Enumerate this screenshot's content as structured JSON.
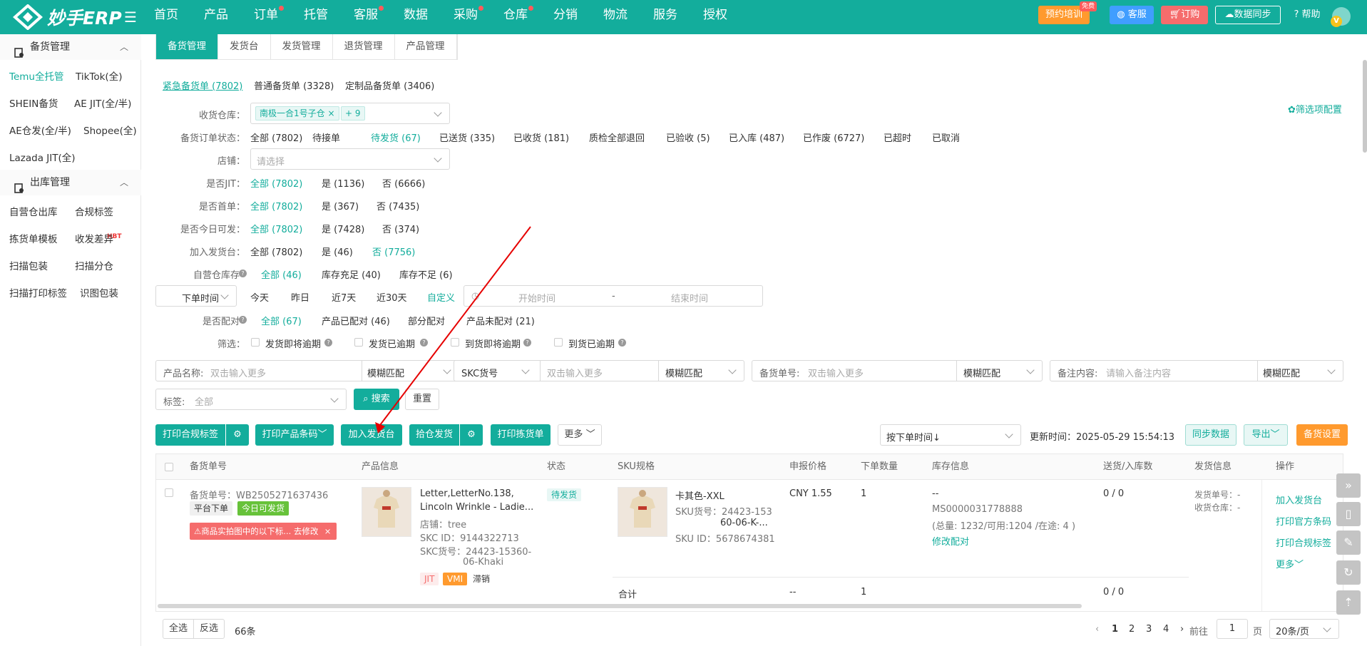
{
  "app": {
    "name": "妙手ERP"
  },
  "nav": [
    {
      "label": "首页",
      "dot": false
    },
    {
      "label": "产品",
      "dot": false
    },
    {
      "label": "订单",
      "dot": true
    },
    {
      "label": "托管",
      "dot": false
    },
    {
      "label": "客服",
      "dot": true
    },
    {
      "label": "数据",
      "dot": false
    },
    {
      "label": "采购",
      "dot": true
    },
    {
      "label": "仓库",
      "dot": true
    },
    {
      "label": "分销",
      "dot": false
    },
    {
      "label": "物流",
      "dot": false
    },
    {
      "label": "服务",
      "dot": false
    },
    {
      "label": "授权",
      "dot": false
    }
  ],
  "topright": {
    "training": "预约培训",
    "free_badge": "免费",
    "service": "客服",
    "order": "订购",
    "sync": "数据同步",
    "help": "帮助",
    "avatar_letter": "V"
  },
  "sidebar": {
    "sec1": "备货管理",
    "sec2": "出库管理",
    "items1": [
      "Temu全托管",
      "TikTok(全)",
      "SHEIN备货",
      "AE JIT(全/半)",
      "AE仓发(全/半)",
      "Shopee(全)",
      "Lazada JIT(全)"
    ],
    "items2": [
      "自营仓出库",
      "合规标签",
      "拣货单模板",
      "收发差异",
      "扫描包装",
      "扫描分仓",
      "扫描打印标签",
      "识图包装"
    ],
    "hbt": "HBT"
  },
  "tabs": [
    "备货管理",
    "发货台",
    "发货管理",
    "退货管理",
    "产品管理"
  ],
  "subtabs": [
    "紧急备货单 (7802)",
    "普通备货单 (3328)",
    "定制品备货单 (3406)"
  ],
  "filter_config": "筛选项配置",
  "filters": {
    "warehouse": {
      "label": "收货仓库：",
      "chip": "南极一合1号子仓",
      "more": "+ 9"
    },
    "status": {
      "label": "备货订单状态：",
      "options": [
        "全部 (7802)",
        "待接单",
        "待发货 (67)",
        "已送货 (335)",
        "已收货 (181)",
        "质检全部退回",
        "已验收 (5)",
        "已入库 (487)",
        "已作废 (6727)",
        "已超时",
        "已取消"
      ]
    },
    "shop": {
      "label": "店铺：",
      "placeholder": "请选择"
    },
    "jit": {
      "label": "是否JIT：",
      "options": [
        "全部 (7802)",
        "是 (1136)",
        "否 (6666)"
      ]
    },
    "first": {
      "label": "是否首单：",
      "options": [
        "全部 (7802)",
        "是 (367)",
        "否 (7435)"
      ]
    },
    "today": {
      "label": "是否今日可发：",
      "options": [
        "全部 (7802)",
        "是 (7428)",
        "否 (374)"
      ]
    },
    "desk": {
      "label": "加入发货台：",
      "options": [
        "全部 (7802)",
        "是 (46)",
        "否 (7756)"
      ]
    },
    "stock": {
      "label": "自营仓库存",
      "options": [
        "全部 (46)",
        "库存充足 (40)",
        "库存不足 (6)"
      ]
    },
    "time": {
      "select": "下单时间",
      "options": [
        "今天",
        "昨日",
        "近7天",
        "近30天",
        "自定义"
      ],
      "start": "开始时间",
      "sep": "-",
      "end": "结束时间"
    },
    "paired": {
      "label": "是否配对",
      "options": [
        "全部 (67)",
        "产品已配对 (46)",
        "部分配对",
        "产品未配对 (21)"
      ]
    },
    "screen": {
      "label": "筛选：",
      "options": [
        "发货即将逾期",
        "发货已逾期",
        "到货即将逾期",
        "到货已逾期"
      ]
    }
  },
  "search": {
    "product_label": "产品名称:",
    "product_ph": "双击输入更多",
    "match": "模糊匹配",
    "skc_select": "SKC货号",
    "skc_ph": "双击输入更多",
    "order_label": "备货单号:",
    "order_ph": "双击输入更多",
    "note_label": "备注内容:",
    "note_ph": "请输入备注内容",
    "tag_label": "标签:",
    "tag_value": "全部",
    "search_btn": "搜索",
    "reset_btn": "重置"
  },
  "actions": {
    "print_compliance": "打印合规标签",
    "print_barcode": "打印产品条码",
    "add_desk": "加入发货台",
    "pick_ship": "拾仓发货",
    "print_pick": "打印拣货单",
    "more": "更多",
    "sort": "按下单时间↓",
    "update_time": "更新时间：2025-05-29 15:54:13",
    "sync": "同步数据",
    "export": "导出",
    "settings": "备货设置"
  },
  "table": {
    "headers": [
      "备货单号",
      "产品信息",
      "状态",
      "SKU规格",
      "申报价格",
      "下单数量",
      "库存信息",
      "送货/入库数",
      "发货信息",
      "操作"
    ],
    "row": {
      "order_no": "备货单号：WB2505271637436",
      "platform": "平台下单",
      "today_tag": "今日可发货",
      "warn": "⚠商品实拍图中的以下标... 去修改",
      "prod_name1": "Letter,LetterNo.138,",
      "prod_name2": "Lincoln Wrinkle - Ladie...",
      "shop": "店铺：tree",
      "skc_id": "SKC ID：9144322713",
      "skc_no1": "SKC货号：24423-15360-",
      "skc_no2": "06-Khaki",
      "tags": [
        "JIT",
        "VMI",
        "滞销"
      ],
      "status": "待发货",
      "sku_name": "卡其色-XXL",
      "sku_no1": "SKU货号：24423-153",
      "sku_no2": "60-06-K-...",
      "sku_id": "SKU ID：5678674381",
      "price": "CNY 1.55",
      "qty": "1",
      "stock_dash": "--",
      "stock_code": "MS0000031778888",
      "stock_detail": "(总量: 1232/可用:1204 /在途: 4 )",
      "modify_pair": "修改配对",
      "delivered": "0 / 0",
      "ship_no": "发货单号：-",
      "ship_wh": "收货仓库：-",
      "ops": [
        "加入发货台",
        "打印官方条码",
        "打印合规标签",
        "更多"
      ]
    },
    "total": {
      "label": "合计",
      "price": "--",
      "qty": "1",
      "delivered": "0 / 0"
    }
  },
  "footer": {
    "select_all": "全选",
    "invert": "反选",
    "count": "66条",
    "pages": [
      "1",
      "2",
      "3",
      "4"
    ],
    "goto": "前往",
    "page_input": "1",
    "page_unit": "页",
    "page_size": "20条/页"
  },
  "colors": {
    "primary": "#13ad9c",
    "danger": "#f56c6c",
    "orange": "#ff9a2e",
    "red": "#e33"
  }
}
